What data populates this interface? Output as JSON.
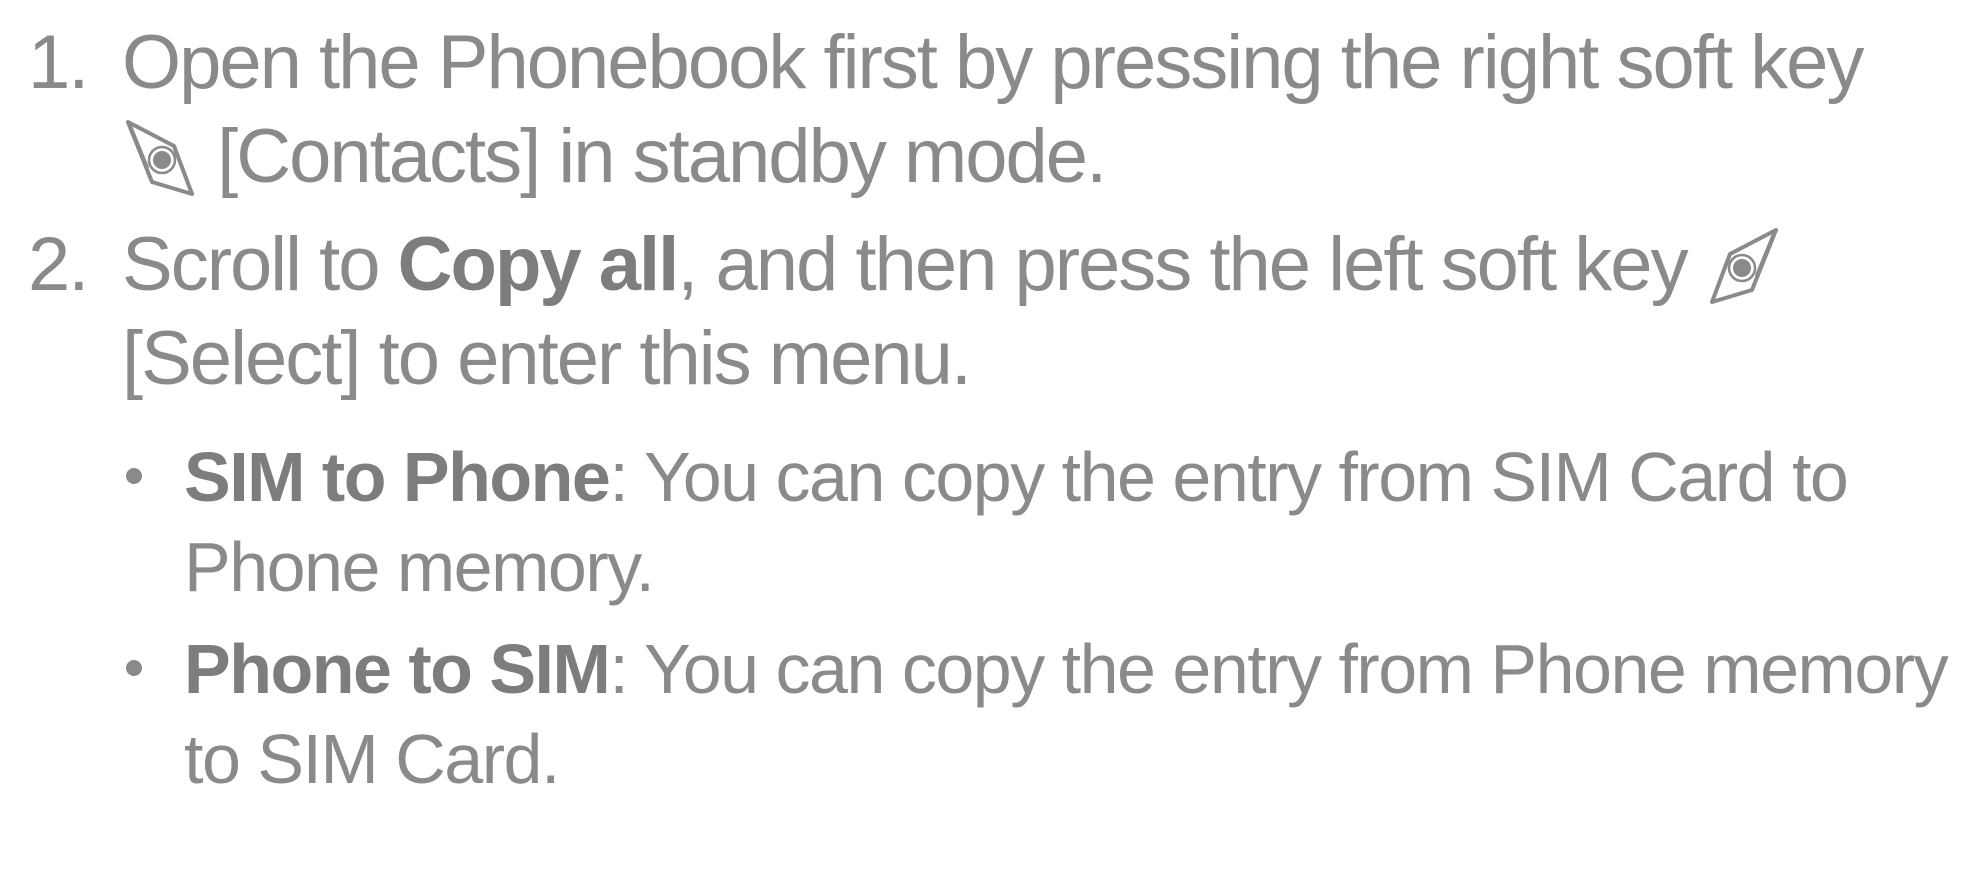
{
  "steps": [
    {
      "number": "1.",
      "text_before_icon": "Open the Phonebook first by pressing the right soft key",
      "icon": "right-soft-key-icon",
      "text_after_icon": "[Contacts] in standby mode."
    },
    {
      "number": "2.",
      "text_before_bold": "Scroll to ",
      "bold": "Copy all",
      "text_before_icon": ", and then press the left soft key",
      "icon": "left-soft-key-icon",
      "text_after_icon": "[Select] to enter this menu."
    }
  ],
  "bullets": [
    {
      "bold": "SIM to Phone",
      "text": ": You can copy the entry from SIM Card to Phone memory."
    },
    {
      "bold": "Phone to SIM",
      "text": ": You can copy the entry from Phone memory to SIM Card."
    }
  ],
  "colors": {
    "text": "#8a8a8a",
    "bold_text": "#7d7d7d",
    "background": "#ffffff"
  }
}
